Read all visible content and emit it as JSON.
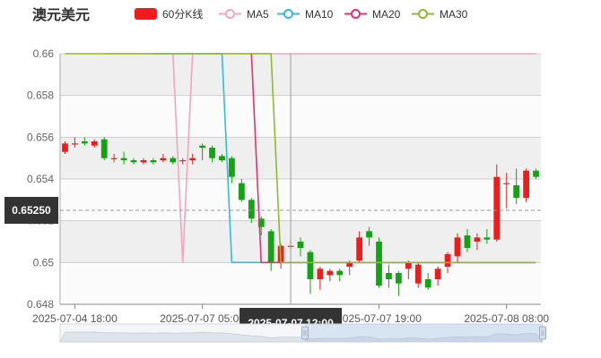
{
  "header": {
    "title": "澳元美元"
  },
  "legend": [
    {
      "label": "60分K线",
      "color": "#ef1c1c",
      "kind": "rect"
    },
    {
      "label": "MA5",
      "color": "#f2a5c0",
      "kind": "line"
    },
    {
      "label": "MA10",
      "color": "#2dbfd6",
      "kind": "line"
    },
    {
      "label": "MA20",
      "color": "#e0336f",
      "kind": "line"
    },
    {
      "label": "MA30",
      "color": "#8fb92c",
      "kind": "line"
    }
  ],
  "crosshair": {
    "price_label": "0.65250",
    "time_label": "2025-07-07 12:00"
  },
  "chart_data": {
    "type": "candlestick",
    "ylim": [
      0.648,
      0.66
    ],
    "y_ticks": [
      "0.66",
      "0.658",
      "0.656",
      "0.654",
      "0.652",
      "0.65",
      "0.648"
    ],
    "x_ticks": [
      "2025-07-04 18:00",
      "2025-07-07 05:00",
      "2025-07-07 19:00",
      "2025-07-08 08:00"
    ],
    "up_color": "#ef1c1c",
    "down_color": "#14a314",
    "candles": [
      [
        0.6553,
        0.6557,
        0.6552,
        0.6558
      ],
      [
        0.6557,
        0.6557,
        0.6555,
        0.656
      ],
      [
        0.6558,
        0.6557,
        0.6556,
        0.656
      ],
      [
        0.6556,
        0.6558,
        0.6555,
        0.6559
      ],
      [
        0.6559,
        0.655,
        0.6549,
        0.656
      ],
      [
        0.655,
        0.655,
        0.6548,
        0.6552
      ],
      [
        0.655,
        0.6549,
        0.6547,
        0.6553
      ],
      [
        0.6549,
        0.6548,
        0.6547,
        0.655
      ],
      [
        0.6548,
        0.6549,
        0.6547,
        0.655
      ],
      [
        0.6549,
        0.6548,
        0.6547,
        0.655
      ],
      [
        0.6549,
        0.655,
        0.6548,
        0.6552
      ],
      [
        0.655,
        0.6548,
        0.6547,
        0.6551
      ],
      [
        0.6549,
        0.6549,
        0.6547,
        0.655
      ],
      [
        0.6549,
        0.655,
        0.6547,
        0.6552
      ],
      [
        0.6556,
        0.6555,
        0.6549,
        0.6557
      ],
      [
        0.6555,
        0.655,
        0.6548,
        0.6556
      ],
      [
        0.6551,
        0.6549,
        0.6548,
        0.6552
      ],
      [
        0.655,
        0.6541,
        0.6538,
        0.6551
      ],
      [
        0.6538,
        0.653,
        0.6529,
        0.654
      ],
      [
        0.653,
        0.6521,
        0.6519,
        0.6531
      ],
      [
        0.6521,
        0.6517,
        0.6513,
        0.6522
      ],
      [
        0.6515,
        0.65,
        0.6496,
        0.6516
      ],
      [
        0.65,
        0.6508,
        0.6497,
        0.6509
      ],
      [
        0.6508,
        0.6508,
        0.6506,
        0.6511
      ],
      [
        0.651,
        0.6507,
        0.6503,
        0.6512
      ],
      [
        0.6505,
        0.6492,
        0.6485,
        0.6506
      ],
      [
        0.6492,
        0.6497,
        0.6487,
        0.6498
      ],
      [
        0.6494,
        0.6496,
        0.6491,
        0.6497
      ],
      [
        0.6496,
        0.6494,
        0.6491,
        0.6497
      ],
      [
        0.6498,
        0.65,
        0.6494,
        0.6501
      ],
      [
        0.6501,
        0.6512,
        0.65,
        0.6515
      ],
      [
        0.6515,
        0.6512,
        0.6508,
        0.6517
      ],
      [
        0.651,
        0.6489,
        0.6488,
        0.6512
      ],
      [
        0.6495,
        0.6492,
        0.6488,
        0.6499
      ],
      [
        0.6495,
        0.649,
        0.6484,
        0.6496
      ],
      [
        0.6497,
        0.65,
        0.6492,
        0.6501
      ],
      [
        0.649,
        0.6499,
        0.6488,
        0.65
      ],
      [
        0.6492,
        0.6488,
        0.6487,
        0.6495
      ],
      [
        0.6492,
        0.6497,
        0.6489,
        0.6498
      ],
      [
        0.6498,
        0.6504,
        0.6495,
        0.6505
      ],
      [
        0.6503,
        0.6512,
        0.65,
        0.6514
      ],
      [
        0.6513,
        0.6507,
        0.6505,
        0.6516
      ],
      [
        0.651,
        0.6512,
        0.6506,
        0.6514
      ],
      [
        0.6512,
        0.6511,
        0.6509,
        0.6516
      ],
      [
        0.6511,
        0.6541,
        0.651,
        0.6547
      ],
      [
        0.6538,
        0.6538,
        0.6526,
        0.6543
      ],
      [
        0.6537,
        0.6531,
        0.6528,
        0.6545
      ],
      [
        0.6531,
        0.6544,
        0.6529,
        0.6545
      ],
      [
        0.6544,
        0.6541,
        0.654,
        0.6545
      ]
    ],
    "ma5": [
      null,
      null,
      null,
      null,
      0.66,
      0.66,
      0.66,
      0.66,
      0.66,
      0.66,
      0.66,
      0.66,
      0.65,
      0.66,
      0.66,
      0.66,
      0.66,
      0.66,
      0.66,
      0.66,
      0.66,
      0.66,
      0.66,
      0.66,
      0.66,
      0.66,
      0.66,
      0.66,
      0.66,
      0.66,
      0.66,
      0.66,
      0.66,
      0.66,
      0.66,
      0.66,
      0.66,
      0.66,
      0.66,
      0.66,
      0.66,
      0.66,
      0.66,
      0.66,
      0.66,
      0.66,
      0.66,
      0.66,
      0.66
    ],
    "ma10": [
      null,
      null,
      null,
      null,
      null,
      null,
      null,
      null,
      null,
      0.66,
      0.66,
      0.66,
      0.66,
      0.66,
      0.66,
      0.66,
      0.66,
      0.65,
      0.65,
      0.65,
      0.65,
      0.65,
      0.65,
      0.65,
      0.65,
      0.65,
      0.65,
      0.65,
      0.65,
      0.65,
      0.65,
      0.65,
      0.65,
      0.65,
      0.65,
      0.65,
      0.65,
      0.65,
      0.65,
      0.65,
      0.65,
      0.65,
      0.65,
      0.65,
      0.65,
      0.65,
      0.65,
      0.65,
      0.65
    ],
    "ma20": [
      null,
      null,
      null,
      null,
      null,
      null,
      null,
      null,
      null,
      null,
      null,
      null,
      null,
      null,
      null,
      null,
      null,
      null,
      null,
      0.66,
      0.65,
      0.65,
      0.65,
      0.65,
      0.65,
      0.65,
      0.65,
      0.65,
      0.65,
      0.65,
      0.65,
      0.65,
      0.65,
      0.65,
      0.65,
      0.65,
      0.65,
      0.65,
      0.65,
      0.65,
      0.65,
      0.65,
      0.65,
      0.65,
      0.65,
      0.65,
      0.65,
      0.65,
      0.65
    ],
    "ma30": [
      0.66,
      0.66,
      0.66,
      0.66,
      0.66,
      0.66,
      0.66,
      0.66,
      0.66,
      0.66,
      0.66,
      0.66,
      0.66,
      0.66,
      0.66,
      0.66,
      0.66,
      0.66,
      0.66,
      0.66,
      0.66,
      0.66,
      0.65,
      0.65,
      0.65,
      0.65,
      0.65,
      0.65,
      0.65,
      0.65,
      0.65,
      0.65,
      0.65,
      0.65,
      0.65,
      0.65,
      0.65,
      0.65,
      0.65,
      0.65,
      0.65,
      0.65,
      0.65,
      0.65,
      0.65,
      0.65,
      0.65,
      0.65,
      0.65
    ]
  }
}
